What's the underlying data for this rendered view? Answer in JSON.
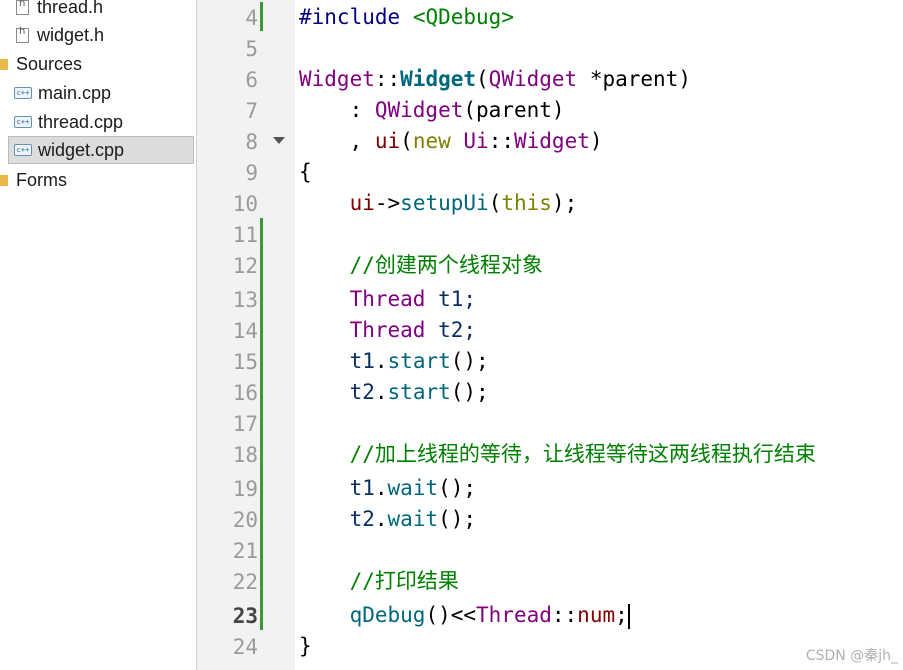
{
  "sidebar": {
    "items": [
      {
        "label": "thread.h",
        "kind": "header-file",
        "icon": "header-file-icon"
      },
      {
        "label": "widget.h",
        "kind": "header-file",
        "icon": "header-file-icon"
      },
      {
        "label": "Sources",
        "kind": "folder",
        "icon": "sources-folder-icon"
      },
      {
        "label": "main.cpp",
        "kind": "source-file",
        "icon": "cpp-file-icon"
      },
      {
        "label": "thread.cpp",
        "kind": "source-file",
        "icon": "cpp-file-icon"
      },
      {
        "label": "widget.cpp",
        "kind": "source-file",
        "icon": "cpp-file-icon",
        "selected": true
      },
      {
        "label": "Forms",
        "kind": "folder",
        "icon": "forms-folder-icon"
      }
    ]
  },
  "editor": {
    "current_line": 23,
    "line_numbers": [
      "4",
      "5",
      "6",
      "7",
      "8",
      "9",
      "10",
      "11",
      "12",
      "13",
      "14",
      "15",
      "16",
      "17",
      "18",
      "19",
      "20",
      "21",
      "22",
      "23",
      "24"
    ],
    "code": {
      "l4": [
        "#include",
        " ",
        "<QDebug>"
      ],
      "l6": [
        "Widget",
        "::",
        "Widget",
        "(",
        "QWidget",
        " *parent)"
      ],
      "l7": [
        "    : ",
        "QWidget",
        "(parent)"
      ],
      "l8": [
        "    , ",
        "ui",
        "(",
        "new",
        " ",
        "Ui",
        "::",
        "Widget",
        ")"
      ],
      "l9": [
        "{"
      ],
      "l10": [
        "    ",
        "ui",
        "->",
        "setupUi",
        "(",
        "this",
        ");"
      ],
      "l12": [
        "    //创建两个线程对象"
      ],
      "l13": [
        "    ",
        "Thread",
        " t1;"
      ],
      "l14": [
        "    ",
        "Thread",
        " t2;"
      ],
      "l15": [
        "    ",
        "t1",
        ".",
        "start",
        "();"
      ],
      "l16": [
        "    ",
        "t2",
        ".",
        "start",
        "();"
      ],
      "l18": [
        "    //加上线程的等待，让线程等待这两线程执行结束"
      ],
      "l19": [
        "    ",
        "t1",
        ".",
        "wait",
        "();"
      ],
      "l20": [
        "    ",
        "t2",
        ".",
        "wait",
        "();"
      ],
      "l22": [
        "    //打印结果"
      ],
      "l23": [
        "    ",
        "qDebug",
        "()<<",
        "Thread",
        "::",
        "num",
        ";"
      ],
      "l24": [
        "}"
      ]
    }
  },
  "watermark": "CSDN @秦jh_",
  "colors": {
    "preprocessor": "#000080",
    "include_path": "#008000",
    "type": "#800080",
    "function": "#00677c",
    "keyword": "#808000",
    "comment": "#008000",
    "member": "#800000",
    "change_bar": "#3a9a3a"
  }
}
